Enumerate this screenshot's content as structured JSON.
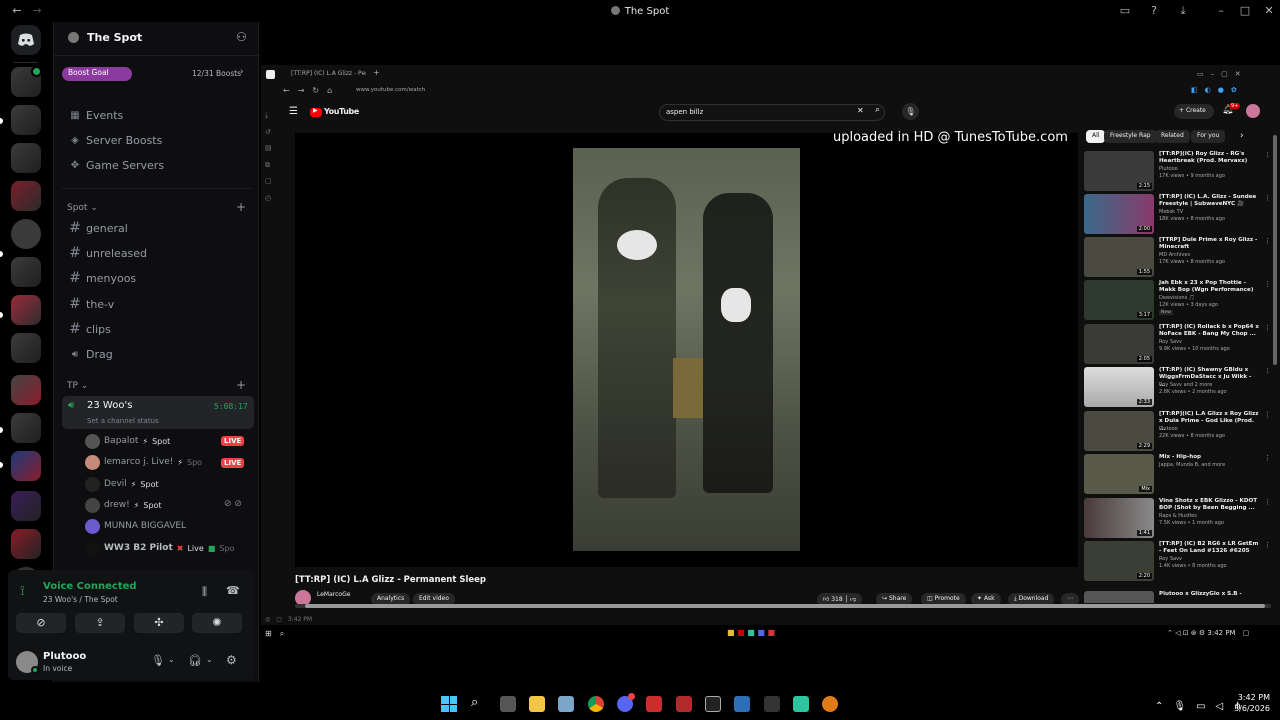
{
  "window": {
    "title": "The Spot"
  },
  "server": {
    "name": "The Spot",
    "boost_label": "Boost Goal",
    "boost_count": "12/31 Boosts"
  },
  "menu": [
    {
      "label": "Events",
      "icon": "calendar-icon"
    },
    {
      "label": "Server Boosts",
      "icon": "boost-icon"
    },
    {
      "label": "Game Servers",
      "icon": "controller-icon"
    }
  ],
  "categories": {
    "spot": "Spot",
    "tp": "TP"
  },
  "channels": [
    "general",
    "unreleased",
    "menyoos",
    "the-v",
    "clips"
  ],
  "voice_channel_drag": "Drag",
  "active_voice": {
    "name": "23 Woo's",
    "timer": "5:08:17",
    "status": "Set a channel status"
  },
  "voice_users": [
    {
      "name": "Bapalot",
      "tag": "Spot",
      "live": "LIVE"
    },
    {
      "name": "lemarco j. Live!",
      "tag": "Spo",
      "live": "LIVE"
    },
    {
      "name": "Devil",
      "tag": "Spot"
    },
    {
      "name": "drew!",
      "tag": "Spot"
    },
    {
      "name": "MUNNA BIGGAVEL"
    },
    {
      "name": "WW3 B2 Pilot",
      "tag": "Live",
      "extra": "Spo"
    }
  ],
  "voice_panel": {
    "status": "Voice Connected",
    "channel": "23 Woo's / The Spot"
  },
  "user": {
    "name": "Plutooo",
    "status": "In voice"
  },
  "browser": {
    "tab_title": "[TT:RP] (IC) L.A Glizz - Perm",
    "url": "www.youtube.com/watch",
    "search_query": "aspen billz",
    "create_label": "Create",
    "notif_count": "9+",
    "brand": "YouTube"
  },
  "video": {
    "title": "[TT:RP] (IC) L.A Glizz - Permanent Sleep",
    "watermark": "uploaded in HD @ TunesToTube.com",
    "channel": "LeMarcoGe",
    "likes": "318",
    "actions": [
      "Analytics",
      "Edit video",
      "Share",
      "Promote",
      "Ask",
      "Download"
    ]
  },
  "chips": [
    "All",
    "Freestyle Rap",
    "Related",
    "For you"
  ],
  "recommendations": [
    {
      "title": "[TT:RP](IC) Roy Glizz - RG's Heartbreak (Prod. Mervaxx)",
      "channel": "Plutooo",
      "meta": "17K views • 9 months ago",
      "duration": "2:15"
    },
    {
      "title": "[TT:RP] (IC) L.A. Glizz - Sundee Freestyle | SubwaveNYC 🎥",
      "channel": "Mebsk TV",
      "meta": "18K views • 8 months ago",
      "duration": "2:00"
    },
    {
      "title": "[TTRP] Dule Prime x Roy Glizz - Minecraft",
      "channel": "MD Archives",
      "meta": "17K views • 8 months ago",
      "duration": "1:55"
    },
    {
      "title": "Jah Ebk x 23 x Pop Thottie - Makk Bop (Wgn Performance)",
      "channel": "Dewvisions 🎵",
      "meta": "12K views • 3 days ago",
      "badge": "New",
      "duration": "3:17"
    },
    {
      "title": "[TT:RP] (IC) Rollack b x Pop64 x NoFace EBK - Bang My Chop ...",
      "channel": "Roy Savv",
      "meta": "9.9K views • 10 months ago",
      "duration": "2:05"
    },
    {
      "title": "(TT:RP) (IC) Shawny GBldu x WiggsFrmDaStacc x Ju Wikk - ...",
      "channel": "Roy Savv and 2 more",
      "meta": "2.8K views • 2 months ago",
      "duration": "2:33"
    },
    {
      "title": "[TT:RP](IC) L.A Glizz x Roy Glizz x Dula Prime - God Like (Prod. ...",
      "channel": "Plutooo",
      "meta": "22K views • 8 months ago",
      "duration": "2:29"
    },
    {
      "title": "Mix - Hip-hop",
      "channel": "Jappa, Munda B, and more",
      "meta": "",
      "duration": "Mix"
    },
    {
      "title": "Vine Shotz x EBK Glizzo - KDOT BOP (Shot by Been Begging ...",
      "channel": "Raps & Hustles",
      "meta": "7.5K views • 1 month ago",
      "duration": "1:41"
    },
    {
      "title": "[TT:RP] (IC) B2 RG6 x LR GetEm - Feet On Land #1326 #6205",
      "channel": "Roy Savv",
      "meta": "1.4K views • 8 months ago",
      "duration": "2:20"
    },
    {
      "title": "Plutooo x GlizzyGlo x S.B -",
      "channel": "",
      "meta": "",
      "duration": ""
    }
  ],
  "browser_clock": "3:42 PM",
  "taskbar": {
    "time": "3:42 PM",
    "date": "3/6/2026"
  },
  "colors": {
    "discord_bg": "#0e0e10",
    "live": "#ed4245",
    "voice_green": "#23a55a",
    "boost_pink": "#8b3a9e"
  }
}
